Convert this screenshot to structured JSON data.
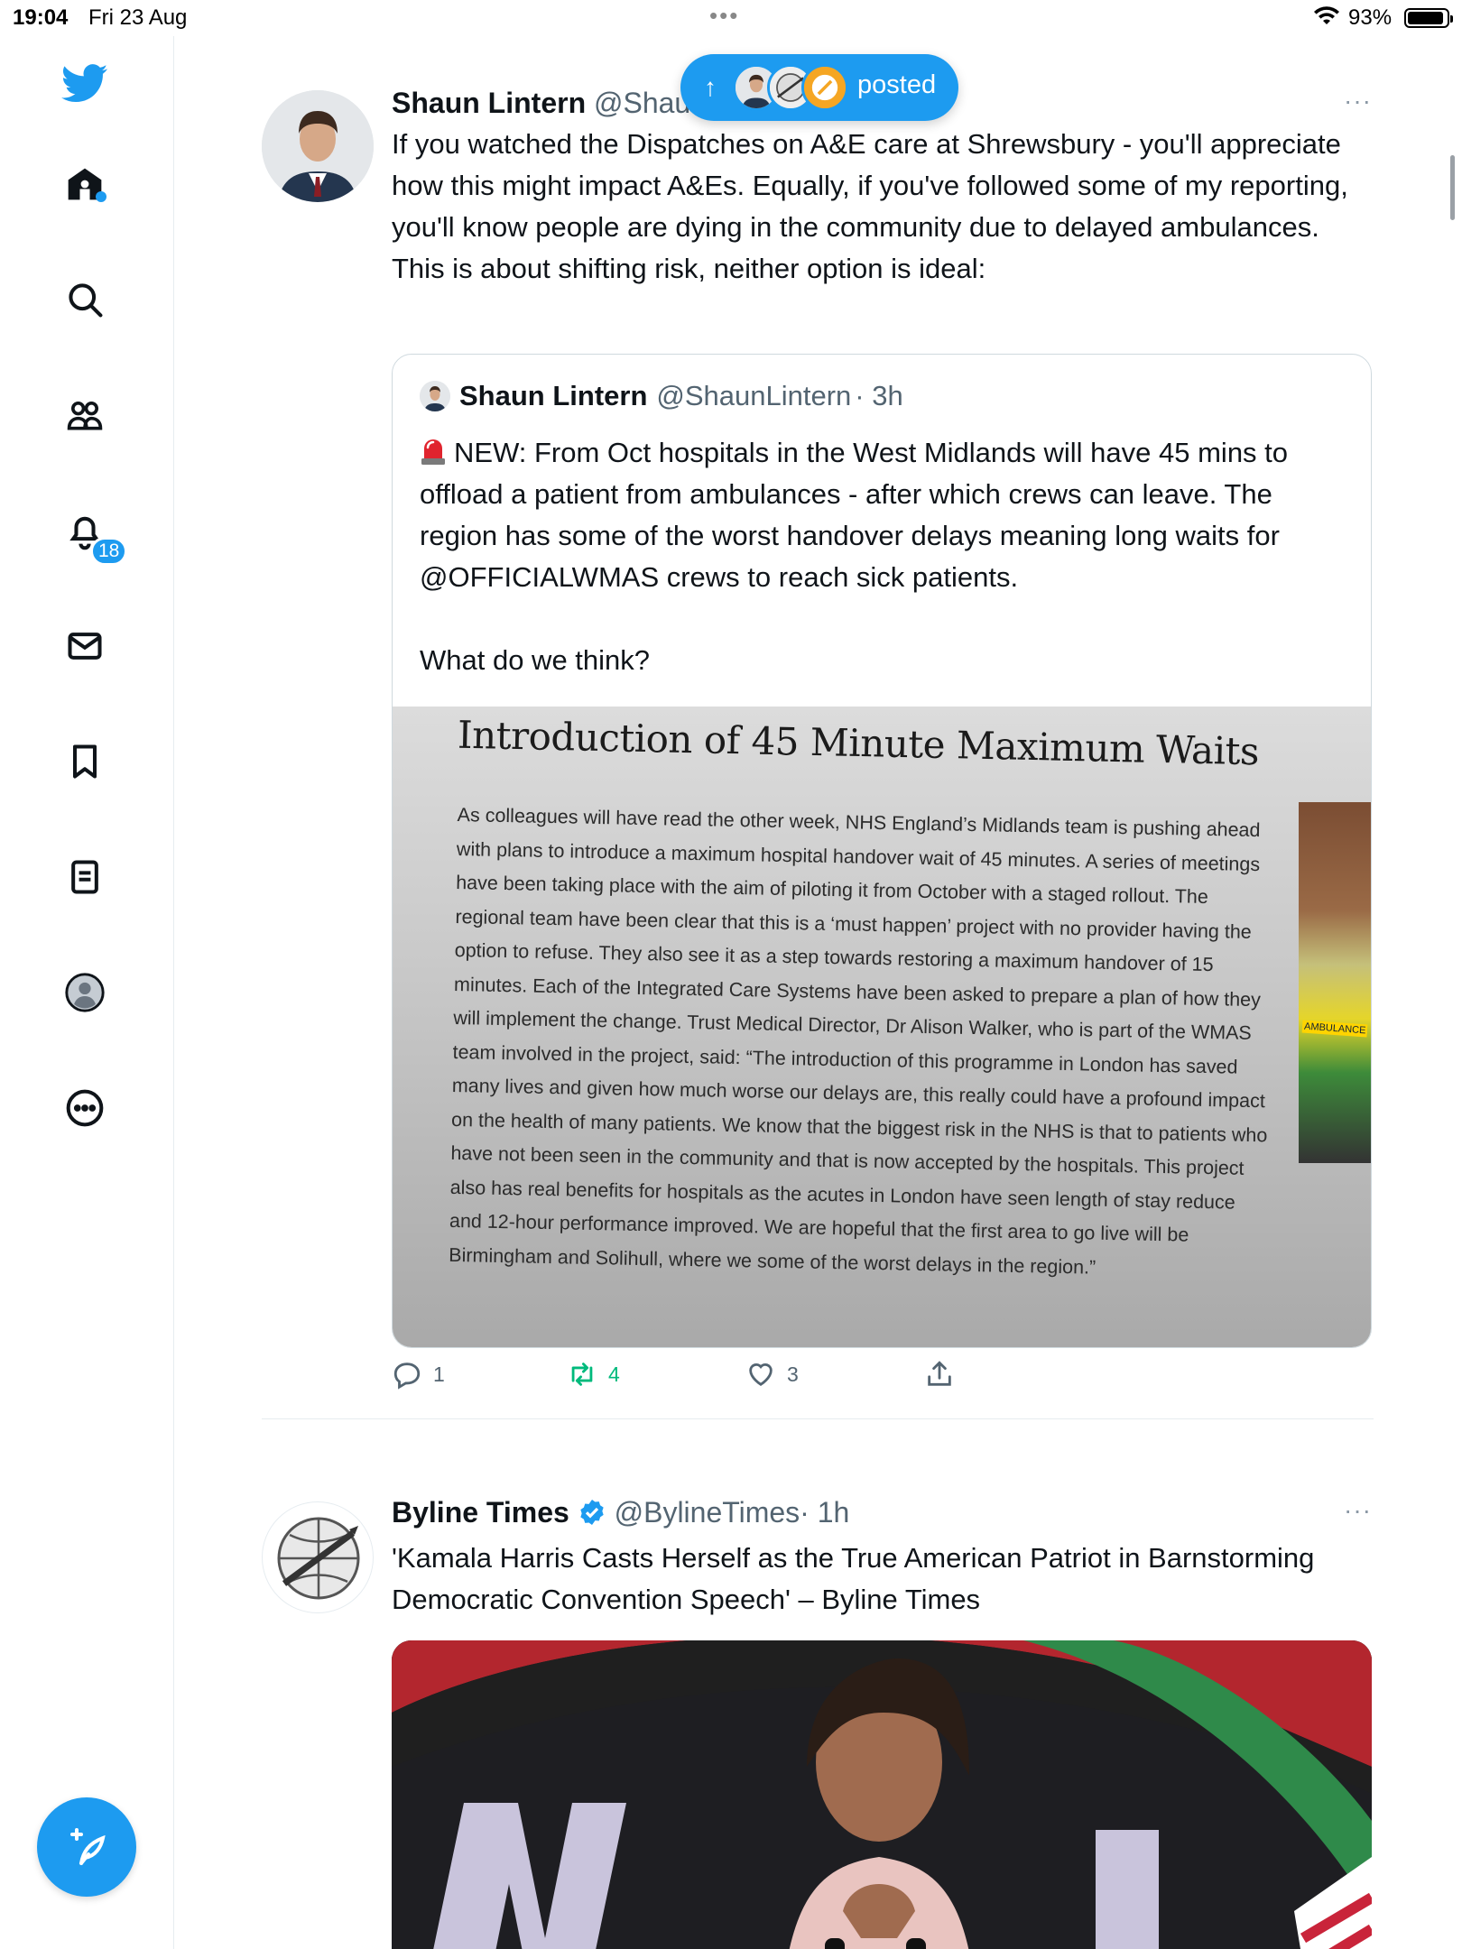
{
  "status_bar": {
    "time": "19:04",
    "date": "Fri 23 Aug",
    "battery_percent": "93%",
    "battery_level": 0.93
  },
  "sidebar": {
    "items": [
      {
        "icon": "twitter-logo-icon"
      },
      {
        "icon": "home-icon"
      },
      {
        "icon": "search-icon"
      },
      {
        "icon": "communities-icon"
      },
      {
        "icon": "notifications-icon",
        "badge": "18"
      },
      {
        "icon": "messages-icon"
      },
      {
        "icon": "bookmarks-icon"
      },
      {
        "icon": "lists-icon"
      },
      {
        "icon": "profile-icon"
      },
      {
        "icon": "more-icon"
      }
    ],
    "compose_icon": "compose-tweet-icon"
  },
  "posted_pill": {
    "label": "posted",
    "arrow": "↑"
  },
  "tweets": [
    {
      "name": "Shaun Lintern",
      "handle": "@Shau",
      "more": "···",
      "text": "If you watched the Dispatches on A&E care at Shrewsbury - you'll appreciate how this might impact A&Es. Equally, if you've followed some of my reporting, you'll know people are dying in the community due to delayed ambulances. This is about shifting risk, neither option is ideal:",
      "quote": {
        "name": "Shaun Lintern",
        "handle": "@ShaunLintern",
        "time": "· 3h",
        "text": "NEW: From Oct hospitals in the West Midlands will have 45 mins to offload a patient from ambulances - after which crews can leave. The region has some of the worst handover delays meaning long waits for @OFFICIALWMAS crews to reach sick patients.",
        "text2": "What do we think?",
        "image": {
          "title": "Introduction of 45 Minute Maximum Waits",
          "body": "As colleagues will have read the other week, NHS England’s Midlands team is pushing ahead with plans to introduce a maximum hospital handover wait of 45 minutes. A series of meetings have been taking place with the aim of piloting it from October with a staged rollout. The regional team have been clear that this is a ‘must happen’ project with no provider having the option to refuse. They also see it as a step towards restoring a maximum handover of 15 minutes. Each of the Integrated Care Systems have been asked to prepare a plan of how they will implement the change. Trust Medical Director, Dr Alison Walker, who is part of the WMAS team involved in the project, said: “The introduction of this programme in London has saved many lives and given how much worse our delays are, this really could have a profound impact on the health of many patients. We know that the biggest risk in the NHS is that to patients who have not been seen in the community and that is now accepted by the hospitals. This project also has real benefits for hospitals as the acutes in London have seen length of stay reduce and 12-hour performance improved. We are hopeful that the first area to go live will be Birmingham and Solihull, where we some of the worst delays in the region.”",
          "photo_label": "AMBULANCE"
        }
      },
      "actions": {
        "replies": "1",
        "retweets": "4",
        "likes": "3"
      }
    },
    {
      "name": "Byline Times",
      "handle": "@BylineTimes",
      "time": "· 1h",
      "more": "···",
      "text": "'Kamala Harris Casts Herself as the True American Patriot in Barnstorming Democratic Convention Speech'  – Byline Times"
    }
  ],
  "colors": {
    "accent": "#1d9bf0",
    "retweet_green": "#00ba7c",
    "text": "#0f1419",
    "muted": "#536471"
  }
}
